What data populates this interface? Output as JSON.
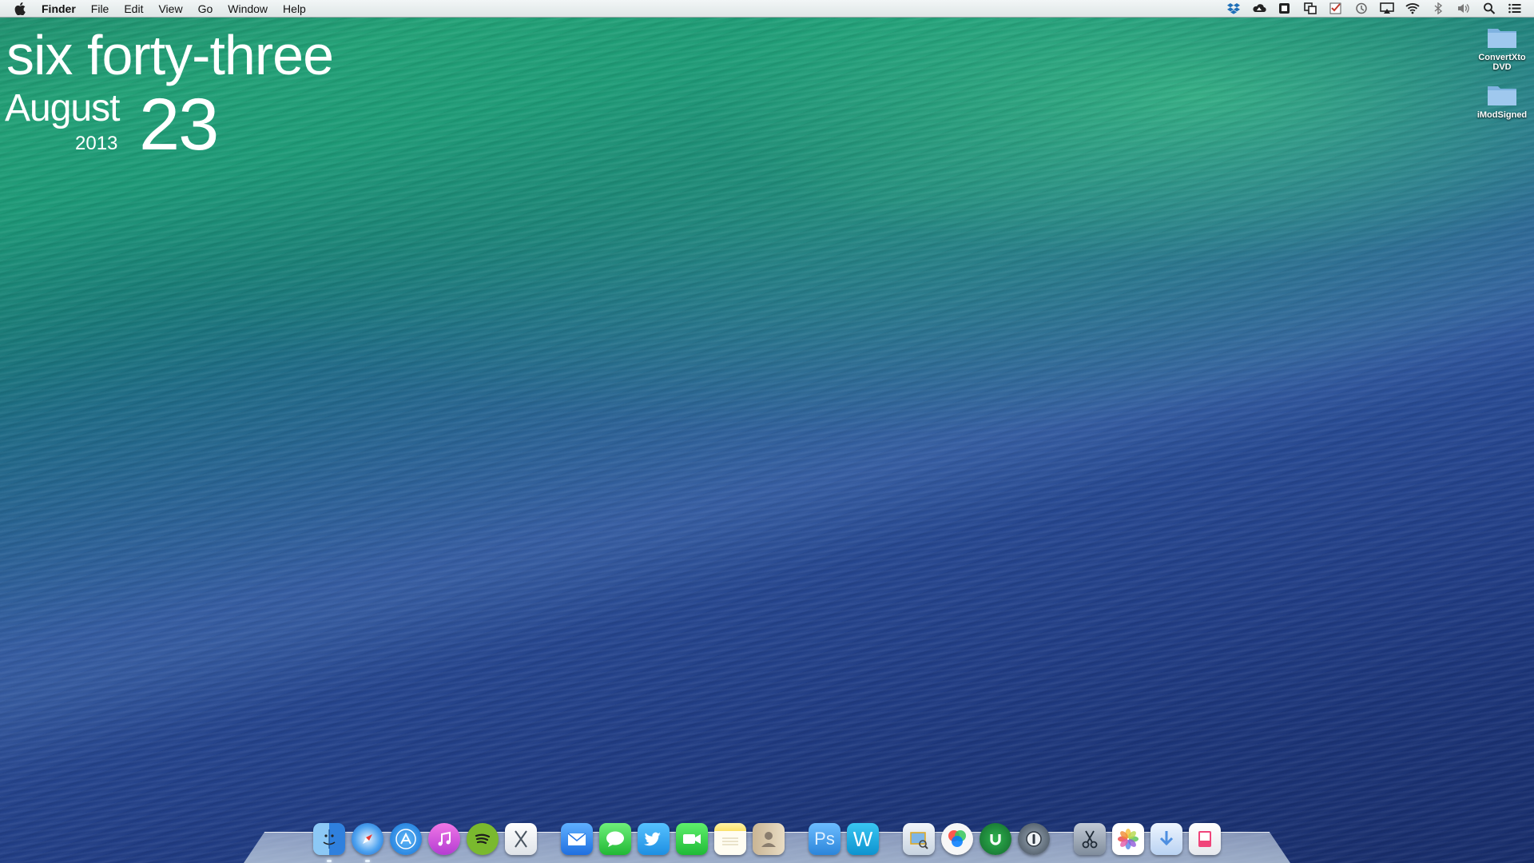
{
  "menubar": {
    "app_name": "Finder",
    "items": [
      "File",
      "Edit",
      "View",
      "Go",
      "Window",
      "Help"
    ],
    "status_icons": [
      "dropbox-icon",
      "cloud-icon",
      "scanner-icon",
      "copy-icon",
      "checkbox-icon",
      "time-machine-icon",
      "airplay-icon",
      "wifi-icon",
      "bluetooth-icon",
      "volume-icon",
      "spotlight-search-icon",
      "notification-center-icon"
    ]
  },
  "clock": {
    "time_words": "six forty-three",
    "month": "August",
    "year": "2013",
    "day": "23"
  },
  "desktop_icons": [
    {
      "label": "ConvertXto DVD",
      "icon": "folder-icon"
    },
    {
      "label": "iModSigned",
      "icon": "folder-icon"
    }
  ],
  "dock": {
    "apps": [
      {
        "name": "Finder",
        "icon": "finder-icon",
        "color": "#3d8ee8",
        "running": true
      },
      {
        "name": "Safari",
        "icon": "safari-icon",
        "color": "#2b7fe0",
        "running": true
      },
      {
        "name": "App Store",
        "icon": "app-store-icon",
        "color": "#1b8de6",
        "running": false
      },
      {
        "name": "iTunes",
        "icon": "itunes-icon",
        "color": "#d44bd6",
        "running": false
      },
      {
        "name": "Spotify",
        "icon": "spotify-icon",
        "color": "#6bb52a",
        "running": false
      },
      {
        "name": "Xcode",
        "icon": "xcode-icon",
        "color": "#f2f4f6",
        "running": false
      },
      {
        "name": "Mail",
        "icon": "mail-icon",
        "color": "#2a86ea",
        "running": false
      },
      {
        "name": "Messages",
        "icon": "messages-icon",
        "color": "#3fd24a",
        "running": false
      },
      {
        "name": "Twitter",
        "icon": "twitter-icon",
        "color": "#2aa3ef",
        "running": false
      },
      {
        "name": "FaceTime",
        "icon": "facetime-icon",
        "color": "#31c845",
        "running": false
      },
      {
        "name": "Notes",
        "icon": "notes-icon",
        "color": "#f7e27a",
        "running": false
      },
      {
        "name": "Contacts",
        "icon": "contacts-icon",
        "color": "#b9a894",
        "running": false
      },
      {
        "name": "Photoshop",
        "icon": "photoshop-icon",
        "color": "#2f8fe0",
        "running": false
      },
      {
        "name": "Word",
        "icon": "word-icon",
        "color": "#19a4d8",
        "running": false
      },
      {
        "name": "Preview",
        "icon": "preview-icon",
        "color": "#d9e4f0",
        "running": false
      },
      {
        "name": "Color Picker",
        "icon": "color-wheel-icon",
        "color": "#ffffff",
        "running": false
      },
      {
        "name": "uTorrent",
        "icon": "utorrent-icon",
        "color": "#1e8a3c",
        "running": false
      },
      {
        "name": "1Password",
        "icon": "1password-icon",
        "color": "#5b6b7a",
        "running": false
      },
      {
        "name": "Cutter",
        "icon": "scissors-icon",
        "color": "#8b97a6",
        "running": false
      },
      {
        "name": "Photos",
        "icon": "photos-icon",
        "color": "#ffffff",
        "running": false
      },
      {
        "name": "Downloads",
        "icon": "downloads-icon",
        "color": "#7fb4f0",
        "running": false
      },
      {
        "name": "Reeder",
        "icon": "reeder-icon",
        "color": "#f04a7a",
        "running": false
      }
    ]
  }
}
